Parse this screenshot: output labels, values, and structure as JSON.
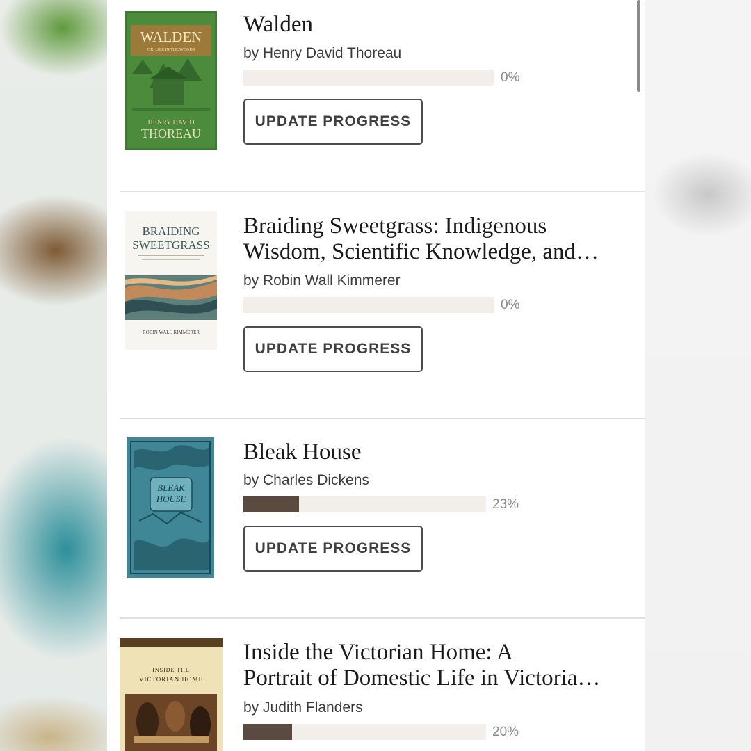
{
  "button_label": "UPDATE PROGRESS",
  "colors": {
    "progress_fill": "#5a4a40",
    "progress_track": "#f2efeb",
    "divider": "#e3e1de"
  },
  "books": [
    {
      "title": "Walden",
      "author": "by Henry David Thoreau",
      "progress": 0,
      "progress_label": "0%",
      "cover": {
        "top_text": "WALDEN",
        "sub_text": "OR, LIFE IN THE WOODS",
        "bottom_text_1": "HENRY DAVID",
        "bottom_text_2": "THOREAU"
      }
    },
    {
      "title": "Braiding Sweetgrass: Indigenous Wisdom, Scientific Knowledge, and…",
      "title_line1": "Braiding Sweetgrass: Indigenous",
      "title_line2": "Wisdom, Scientific Knowledge, and…",
      "author": "by Robin Wall Kimmerer",
      "progress": 0,
      "progress_label": "0%",
      "cover": {
        "top_text_1": "BRAIDING",
        "top_text_2": "SWEETGRASS",
        "bottom_text": "ROBIN WALL KIMMERER"
      }
    },
    {
      "title": "Bleak House",
      "author": "by Charles Dickens",
      "progress": 0.23,
      "progress_label": "23%",
      "cover": {
        "top_text_1": "BLEAK",
        "top_text_2": "HOUSE"
      }
    },
    {
      "title": "Inside the Victorian Home: A Portrait of Domestic Life in Victoria…",
      "title_line1": "Inside the Victorian Home: A",
      "title_line2": "Portrait of Domestic Life in Victoria…",
      "author": "by Judith Flanders",
      "progress": 0.2,
      "progress_label": "20%",
      "cover": {
        "top_text_1": "INSIDE THE",
        "top_text_2": "VICTORIAN HOME"
      }
    }
  ]
}
